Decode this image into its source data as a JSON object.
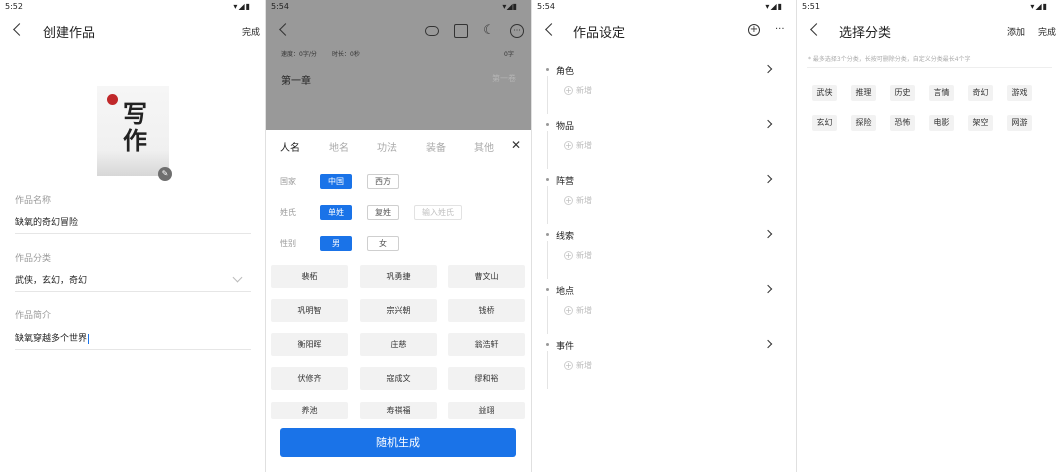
{
  "panel1": {
    "time": "5:52",
    "status_icons": "▾◢▮",
    "title": "创建作品",
    "done": "完成",
    "cover_text": "写作",
    "fields": [
      {
        "label": "作品名称",
        "value": "缺氧的奇幻冒险"
      },
      {
        "label": "作品分类",
        "value": "武侠，玄幻，奇幻"
      },
      {
        "label": "作品简介",
        "value": "缺氧穿越多个世界"
      }
    ]
  },
  "panel2": {
    "time": "5:54",
    "status_icons": "▾◢▮",
    "stat_progress": "速度：0字/分",
    "stat_time": "时长：0秒",
    "stat_words": "0字",
    "chapter": "第一章",
    "chapter_right": "第一卷",
    "tabs": [
      "人名",
      "地名",
      "功法",
      "装备",
      "其他"
    ],
    "country_label": "国家",
    "country_options": [
      "中国",
      "西方"
    ],
    "surname_label": "姓氏",
    "surname_options": [
      "单姓",
      "复姓"
    ],
    "surname_input_placeholder": "输入姓氏",
    "gender_label": "性别",
    "gender_options": [
      "男",
      "女"
    ],
    "names": [
      "裴柘",
      "巩勇捷",
      "曹文山",
      "巩明智",
      "宗兴朝",
      "钱桥",
      "衡阳晖",
      "庄慈",
      "翁浩轩",
      "伏修齐",
      "寇成文",
      "缪和裕",
      "养池",
      "寿祺福",
      "益翊"
    ],
    "generate_button": "随机生成",
    "accent": "#1a73e8"
  },
  "panel3": {
    "time": "5:54",
    "status_icons": "▾◢▮",
    "title": "作品设定",
    "sections": [
      "角色",
      "物品",
      "阵营",
      "线索",
      "地点",
      "事件"
    ],
    "add_label": "新增"
  },
  "panel4": {
    "time": "5:51",
    "status_icons": "▾◢▮",
    "title": "选择分类",
    "add": "添加",
    "done": "完成",
    "hint": "* 最多选择3个分类，长按可删除分类，自定义分类最长4个字",
    "categories_row1": [
      "武侠",
      "推理",
      "历史",
      "言情",
      "奇幻",
      "游戏"
    ],
    "categories_row2": [
      "玄幻",
      "探险",
      "恐怖",
      "电影",
      "架空",
      "网游"
    ]
  }
}
